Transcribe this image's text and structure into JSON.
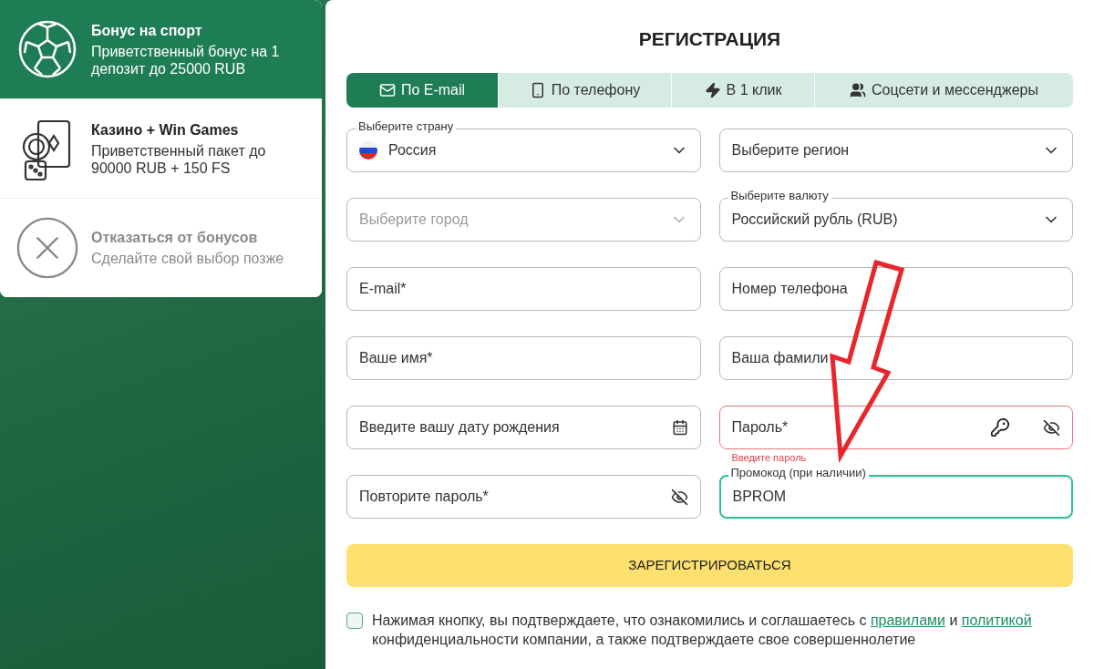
{
  "bonuses": [
    {
      "kind": "sport",
      "title": "Бонус на спорт",
      "subtitle": "Приветственный бонус на 1 депозит до 25000 RUB",
      "selected": true
    },
    {
      "kind": "casino",
      "title": "Казино + Win Games",
      "subtitle": "Приветственный пакет до 90000 RUB + 150 FS",
      "selected": false
    },
    {
      "kind": "decline",
      "title": "Отказаться от бонусов",
      "subtitle": "Сделайте свой выбор позже",
      "selected": false
    }
  ],
  "form": {
    "title": "РЕГИСТРАЦИЯ",
    "tabs": [
      {
        "kind": "email",
        "label": "По E-mail",
        "selected": true
      },
      {
        "kind": "phone",
        "label": "По телефону",
        "selected": false
      },
      {
        "kind": "oneclick",
        "label": "В 1 клик",
        "selected": false
      },
      {
        "kind": "social",
        "label": "Соцсети и мессенджеры",
        "selected": false
      }
    ],
    "rows": [
      [
        {
          "kind": "country",
          "label": "Выберите страну",
          "value": "Россия",
          "disabled": false,
          "invalid": false,
          "focused": false
        },
        {
          "kind": "select",
          "placeholder": "Выберите регион",
          "disabled": false,
          "invalid": false,
          "focused": false
        }
      ],
      [
        {
          "kind": "select",
          "placeholder": "Выберите город",
          "disabled": true,
          "invalid": false,
          "focused": false
        },
        {
          "kind": "select",
          "label": "Выберите валюту",
          "value": "Российский рубль (RUB)",
          "disabled": false,
          "invalid": false,
          "focused": false
        }
      ],
      [
        {
          "kind": "text",
          "placeholder": "E-mail*",
          "disabled": false,
          "invalid": false,
          "focused": false
        },
        {
          "kind": "text",
          "placeholder": "Номер телефона",
          "disabled": false,
          "invalid": false,
          "focused": false
        }
      ],
      [
        {
          "kind": "text",
          "placeholder": "Ваше имя*",
          "disabled": false,
          "invalid": false,
          "focused": false
        },
        {
          "kind": "text",
          "placeholder": "Ваша фамили",
          "disabled": false,
          "invalid": false,
          "focused": false
        }
      ],
      [
        {
          "kind": "date",
          "placeholder": "Введите вашу дату рождения",
          "disabled": false,
          "invalid": false,
          "focused": false
        },
        {
          "kind": "password-generate",
          "placeholder": "Пароль*",
          "error": "Введите пароль",
          "disabled": false,
          "invalid": true,
          "focused": false
        }
      ],
      [
        {
          "kind": "password",
          "placeholder": "Повторите пароль*",
          "disabled": false,
          "invalid": false,
          "focused": false
        },
        {
          "kind": "text",
          "label": "Промокод (при наличии)",
          "value": "BPROM",
          "disabled": false,
          "invalid": false,
          "focused": true
        }
      ]
    ],
    "submit": "ЗАРЕГИСТРИРОВАТЬСЯ",
    "consent": {
      "checked": false,
      "parts": [
        {
          "kind": "text",
          "text": "Нажимая кнопку, вы подтверждаете, что ознакомились и соглашаетесь с "
        },
        {
          "kind": "link",
          "text": "правилами"
        },
        {
          "kind": "text",
          "text": " и "
        },
        {
          "kind": "link",
          "text": "политикой"
        },
        {
          "kind": "text",
          "text": " конфиденциальности компании, а также подтверждаете свое совершеннолетие"
        }
      ]
    }
  }
}
